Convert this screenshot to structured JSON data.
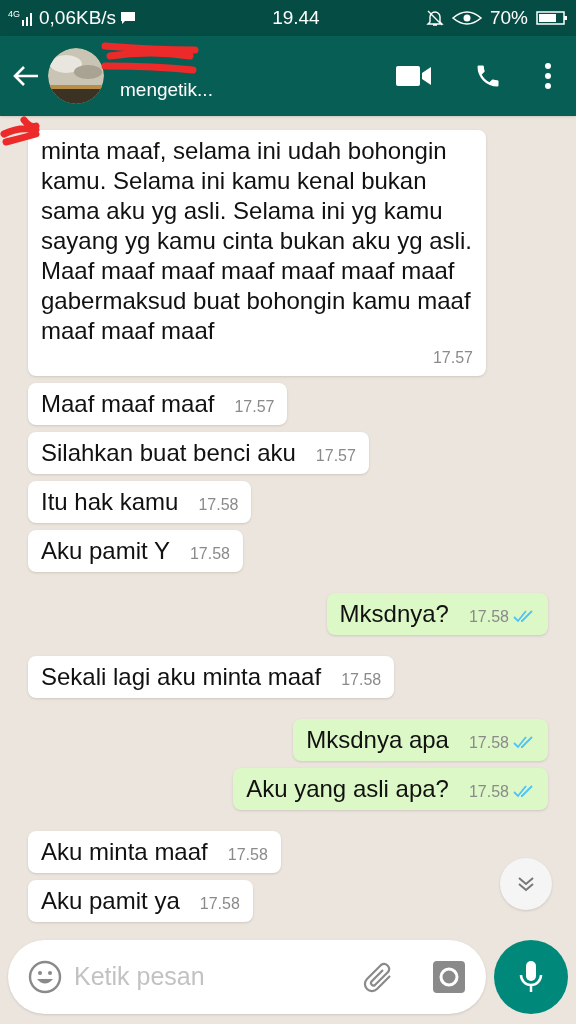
{
  "status_bar": {
    "network": "4G",
    "speed": "0,06KB/s",
    "time": "19.44",
    "battery": "70%"
  },
  "header": {
    "status": "mengetik..."
  },
  "messages": [
    {
      "kind": "incoming",
      "text": "minta maaf, selama ini udah bohongin kamu. Selama ini kamu kenal bukan sama aku yg asli. Selama ini yg kamu sayang yg kamu cinta bukan aku yg asli. Maaf maaf maaf maaf maaf maaf maaf gabermaksud buat bohongin kamu maaf maaf maaf maaf",
      "time": "17.57"
    },
    {
      "kind": "incoming",
      "text": "Maaf maaf maaf",
      "time": "17.57"
    },
    {
      "kind": "incoming",
      "text": "Silahkan buat benci aku",
      "time": "17.57"
    },
    {
      "kind": "incoming",
      "text": "Itu hak kamu",
      "time": "17.58"
    },
    {
      "kind": "incoming",
      "text": "Aku pamit Y",
      "time": "17.58"
    },
    {
      "kind": "outgoing",
      "text": "Mksdnya?",
      "time": "17.58",
      "read": true
    },
    {
      "kind": "incoming",
      "text": "Sekali lagi aku minta maaf",
      "time": "17.58"
    },
    {
      "kind": "outgoing",
      "text": "Mksdnya apa",
      "time": "17.58",
      "read": true
    },
    {
      "kind": "outgoing",
      "text": "Aku yang asli apa?",
      "time": "17.58",
      "read": true
    },
    {
      "kind": "incoming",
      "text": "Aku minta maaf",
      "time": "17.58"
    },
    {
      "kind": "incoming",
      "text": "Aku pamit ya",
      "time": "17.58"
    }
  ],
  "input": {
    "placeholder": "Ketik pesan"
  }
}
